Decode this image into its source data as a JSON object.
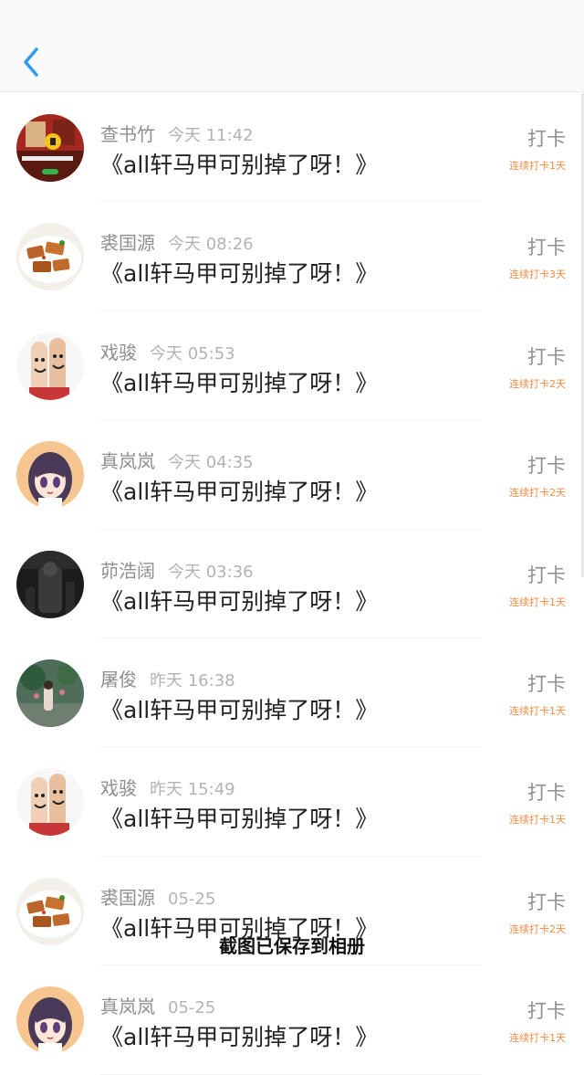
{
  "header": {
    "back_icon": "chevron-left-icon"
  },
  "list": {
    "items": [
      {
        "user": "查书竹",
        "time": "今天 11:42",
        "title": "《all轩马甲可别掉了呀！》",
        "action": "打卡",
        "streak": "连续打卡1天",
        "avatar": "video-thumb"
      },
      {
        "user": "裘国源",
        "time": "今天 08:26",
        "title": "《all轩马甲可别掉了呀！》",
        "action": "打卡",
        "streak": "连续打卡3天",
        "avatar": "food"
      },
      {
        "user": "戏骏",
        "time": "今天 05:53",
        "title": "《all轩马甲可别掉了呀！》",
        "action": "打卡",
        "streak": "连续打卡2天",
        "avatar": "fingers"
      },
      {
        "user": "真岚岚",
        "time": "今天 04:35",
        "title": "《all轩马甲可别掉了呀！》",
        "action": "打卡",
        "streak": "连续打卡2天",
        "avatar": "anime-girl"
      },
      {
        "user": "茆浩阔",
        "time": "今天 03:36",
        "title": "《all轩马甲可别掉了呀！》",
        "action": "打卡",
        "streak": "连续打卡1天",
        "avatar": "dark-photo"
      },
      {
        "user": "屠俊",
        "time": "昨天 16:38",
        "title": "《all轩马甲可别掉了呀！》",
        "action": "打卡",
        "streak": "连续打卡1天",
        "avatar": "garden"
      },
      {
        "user": "戏骏",
        "time": "昨天 15:49",
        "title": "《all轩马甲可别掉了呀！》",
        "action": "打卡",
        "streak": "连续打卡1天",
        "avatar": "fingers"
      },
      {
        "user": "裘国源",
        "time": "05-25",
        "title": "《all轩马甲可别掉了呀！》",
        "action": "打卡",
        "streak": "连续打卡2天",
        "avatar": "food"
      },
      {
        "user": "真岚岚",
        "time": "05-25",
        "title": "《all轩马甲可别掉了呀！》",
        "action": "打卡",
        "streak": "连续打卡1天",
        "avatar": "anime-girl"
      }
    ]
  },
  "toast": {
    "text": "截图已保存到相册"
  },
  "colors": {
    "accent": "#2e9bf0",
    "streak": "#f28c44",
    "text_primary": "#222222",
    "text_secondary": "#8f8f8f"
  }
}
